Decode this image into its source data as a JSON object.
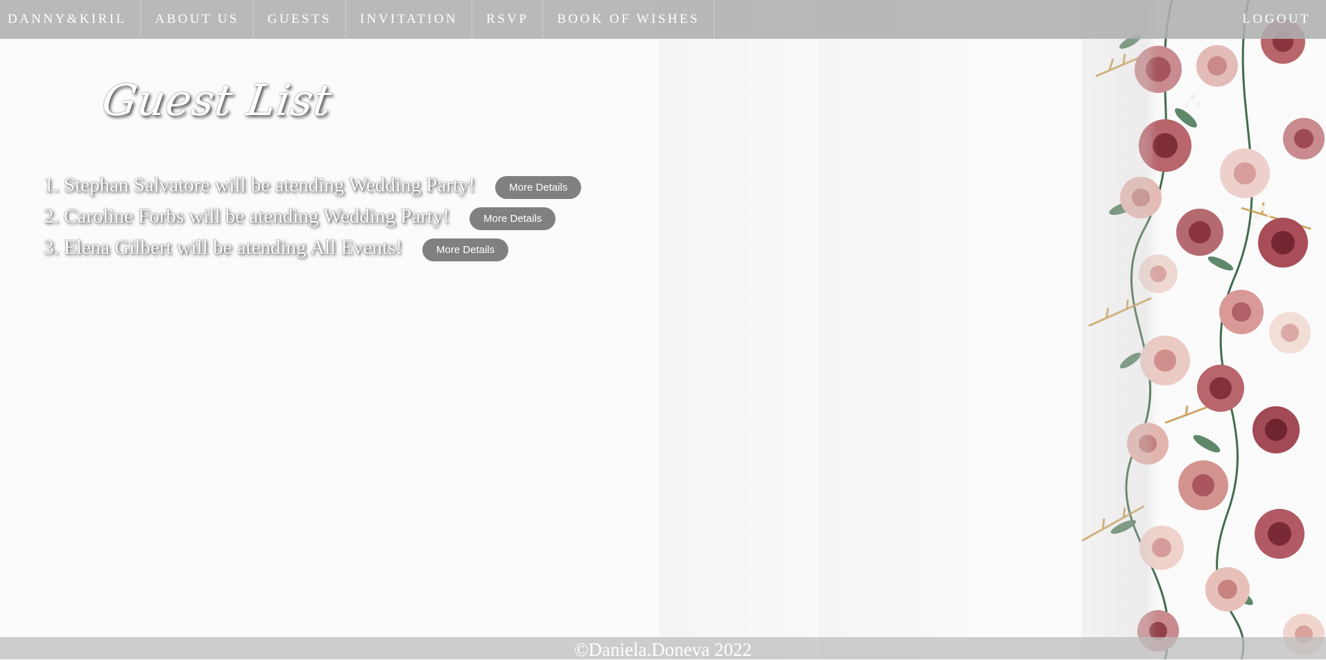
{
  "nav": {
    "brand": "DANNY&KIRIL",
    "items": [
      {
        "label": "ABOUT US"
      },
      {
        "label": "GUESTS"
      },
      {
        "label": "INVITATION"
      },
      {
        "label": "RSVP"
      },
      {
        "label": "BOOK OF WISHES"
      }
    ],
    "logout": "LOGOUT"
  },
  "main": {
    "title": "Guest List",
    "guests": [
      {
        "text": "1. Stephan Salvatore will be atending Wedding Party!",
        "button": "More Details"
      },
      {
        "text": "2. Caroline Forbs will be atending Wedding Party!",
        "button": "More Details"
      },
      {
        "text": "3. Elena Gilbert will be atending All Events!",
        "button": "More Details"
      }
    ]
  },
  "footer": {
    "text": "©Daniela.Doneva 2022"
  },
  "colors": {
    "nav_bg": "#afafaf",
    "button_bg": "#808080",
    "page_bg": "#fbfbfb"
  }
}
